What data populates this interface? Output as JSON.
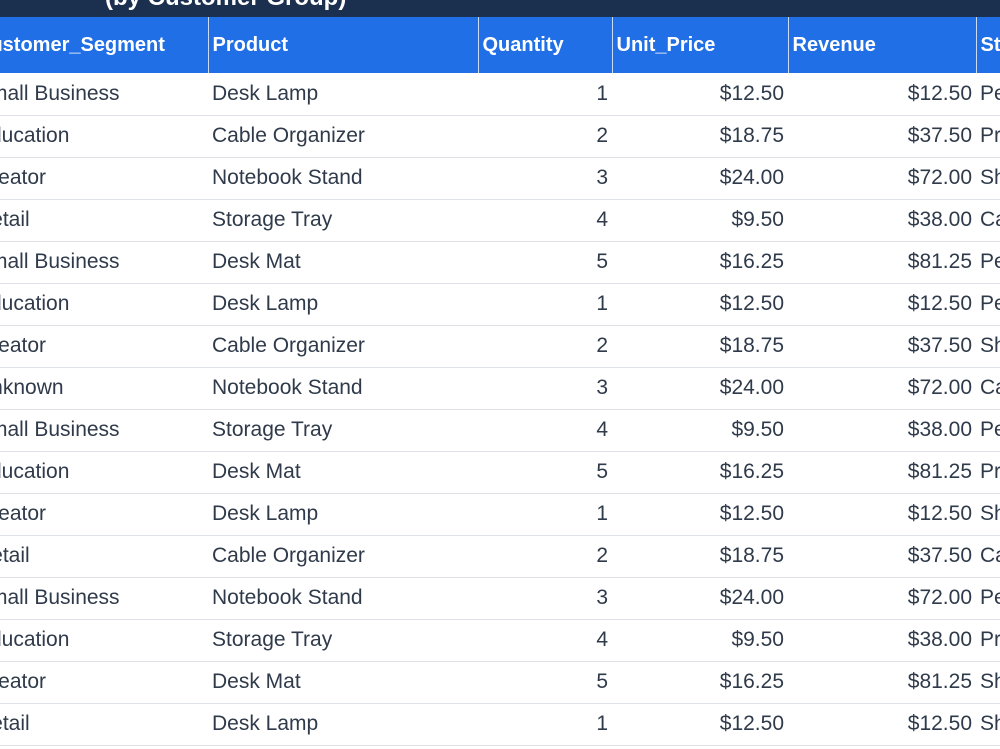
{
  "title": "(by Customer Group)",
  "columns": [
    "Customer_Segment",
    "Product",
    "Quantity",
    "Unit_Price",
    "Revenue",
    "Status"
  ],
  "rows": [
    {
      "segment": "Small Business",
      "product": "Desk Lamp",
      "quantity": "1",
      "unit_price": "$12.50",
      "revenue": "$12.50",
      "status": "Pe"
    },
    {
      "segment": "Education",
      "product": "Cable Organizer",
      "quantity": "2",
      "unit_price": "$18.75",
      "revenue": "$37.50",
      "status": "Pr"
    },
    {
      "segment": "Creator",
      "product": "Notebook Stand",
      "quantity": "3",
      "unit_price": "$24.00",
      "revenue": "$72.00",
      "status": "Sh"
    },
    {
      "segment": "Retail",
      "product": "Storage Tray",
      "quantity": "4",
      "unit_price": "$9.50",
      "revenue": "$38.00",
      "status": "Ca"
    },
    {
      "segment": "Small Business",
      "product": "Desk Mat",
      "quantity": "5",
      "unit_price": "$16.25",
      "revenue": "$81.25",
      "status": "Pe"
    },
    {
      "segment": "Education",
      "product": "Desk Lamp",
      "quantity": "1",
      "unit_price": "$12.50",
      "revenue": "$12.50",
      "status": "Pe"
    },
    {
      "segment": "Creator",
      "product": "Cable Organizer",
      "quantity": "2",
      "unit_price": "$18.75",
      "revenue": "$37.50",
      "status": "Sh"
    },
    {
      "segment": "Unknown",
      "product": "Notebook Stand",
      "quantity": "3",
      "unit_price": "$24.00",
      "revenue": "$72.00",
      "status": "Ca"
    },
    {
      "segment": "Small Business",
      "product": "Storage Tray",
      "quantity": "4",
      "unit_price": "$9.50",
      "revenue": "$38.00",
      "status": "Pe"
    },
    {
      "segment": "Education",
      "product": "Desk Mat",
      "quantity": "5",
      "unit_price": "$16.25",
      "revenue": "$81.25",
      "status": "Pr"
    },
    {
      "segment": "Creator",
      "product": "Desk Lamp",
      "quantity": "1",
      "unit_price": "$12.50",
      "revenue": "$12.50",
      "status": "Sh"
    },
    {
      "segment": "Retail",
      "product": "Cable Organizer",
      "quantity": "2",
      "unit_price": "$18.75",
      "revenue": "$37.50",
      "status": "Ca"
    },
    {
      "segment": "Small Business",
      "product": "Notebook Stand",
      "quantity": "3",
      "unit_price": "$24.00",
      "revenue": "$72.00",
      "status": "Pe"
    },
    {
      "segment": "Education",
      "product": "Storage Tray",
      "quantity": "4",
      "unit_price": "$9.50",
      "revenue": "$38.00",
      "status": "Pr"
    },
    {
      "segment": "Creator",
      "product": "Desk Mat",
      "quantity": "5",
      "unit_price": "$16.25",
      "revenue": "$81.25",
      "status": "Sh"
    },
    {
      "segment": "Retail",
      "product": "Desk Lamp",
      "quantity": "1",
      "unit_price": "$12.50",
      "revenue": "$12.50",
      "status": "Sh"
    }
  ],
  "colors": {
    "title_bar": "#1b2f4e",
    "header": "#216fe6",
    "header_text": "#ffffff",
    "cell_text": "#2f3a4a",
    "row_divider": "#dfe3e8"
  }
}
